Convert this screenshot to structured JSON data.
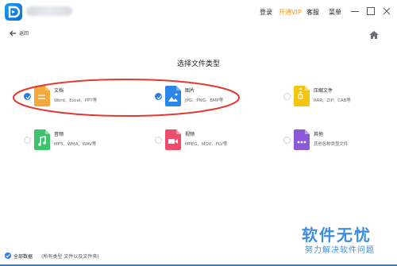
{
  "titlebar": {
    "account_name_icon": "blurred-account-name",
    "links": {
      "login": "登录",
      "vip": "开通VIP",
      "service": "客服",
      "menu": "菜单"
    },
    "window_controls": [
      "minimize-icon",
      "maximize-icon",
      "close-icon"
    ]
  },
  "nav": {
    "back_label": "返回",
    "home_icon": "home-icon"
  },
  "page_title": "选择文件类型",
  "file_types": [
    {
      "name": "文档",
      "desc": "Word、Excel、PPT等",
      "checked": true,
      "icon": "document-icon",
      "color": "#f5a93a"
    },
    {
      "name": "图片",
      "desc": "JPG、PNG、BMP等",
      "checked": true,
      "icon": "image-icon",
      "color": "#2b86e9"
    },
    {
      "name": "压缩文件",
      "desc": "RAR、ZIP、CAB等",
      "checked": false,
      "icon": "archive-icon",
      "color": "#f5c312"
    },
    {
      "name": "音频",
      "desc": "MP3、WMA、WAV等",
      "checked": false,
      "icon": "audio-icon",
      "color": "#3cc36c"
    },
    {
      "name": "视频",
      "desc": "MPEG、MOV、FLV等",
      "checked": false,
      "icon": "video-icon",
      "color": "#ef4b6b"
    },
    {
      "name": "其他",
      "desc": "其他各种类型文件",
      "checked": false,
      "icon": "other-icon",
      "color": "#8c5ad9"
    }
  ],
  "bottom": {
    "all_label": "全部数据",
    "all_desc": "(所有类型 文件以及文件夹)",
    "checked": true
  },
  "watermark": {
    "title": "软件无忧",
    "subtitle": "努力解决软件问题"
  },
  "annotation_color": "#e23a2f"
}
